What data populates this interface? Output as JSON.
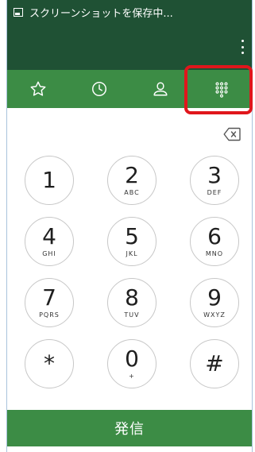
{
  "status_bar": {
    "text": "スクリーンショットを保存中..."
  },
  "tabs": [
    {
      "name": "favorites",
      "icon": "star-icon"
    },
    {
      "name": "recents",
      "icon": "clock-icon"
    },
    {
      "name": "contacts",
      "icon": "person-icon"
    },
    {
      "name": "dialpad",
      "icon": "dialpad-icon",
      "selected": true
    }
  ],
  "keypad": [
    {
      "digit": "1",
      "letters": ""
    },
    {
      "digit": "2",
      "letters": "ABC"
    },
    {
      "digit": "3",
      "letters": "DEF"
    },
    {
      "digit": "4",
      "letters": "GHI"
    },
    {
      "digit": "5",
      "letters": "JKL"
    },
    {
      "digit": "6",
      "letters": "MNO"
    },
    {
      "digit": "7",
      "letters": "PQRS"
    },
    {
      "digit": "8",
      "letters": "TUV"
    },
    {
      "digit": "9",
      "letters": "WXYZ"
    },
    {
      "digit": "*",
      "letters": ""
    },
    {
      "digit": "0",
      "letters": "+"
    },
    {
      "digit": "#",
      "letters": ""
    }
  ],
  "call_button": {
    "label": "発信"
  },
  "colors": {
    "dark_green": "#1f5134",
    "green": "#3c8c45",
    "highlight_red": "#e0161c"
  }
}
